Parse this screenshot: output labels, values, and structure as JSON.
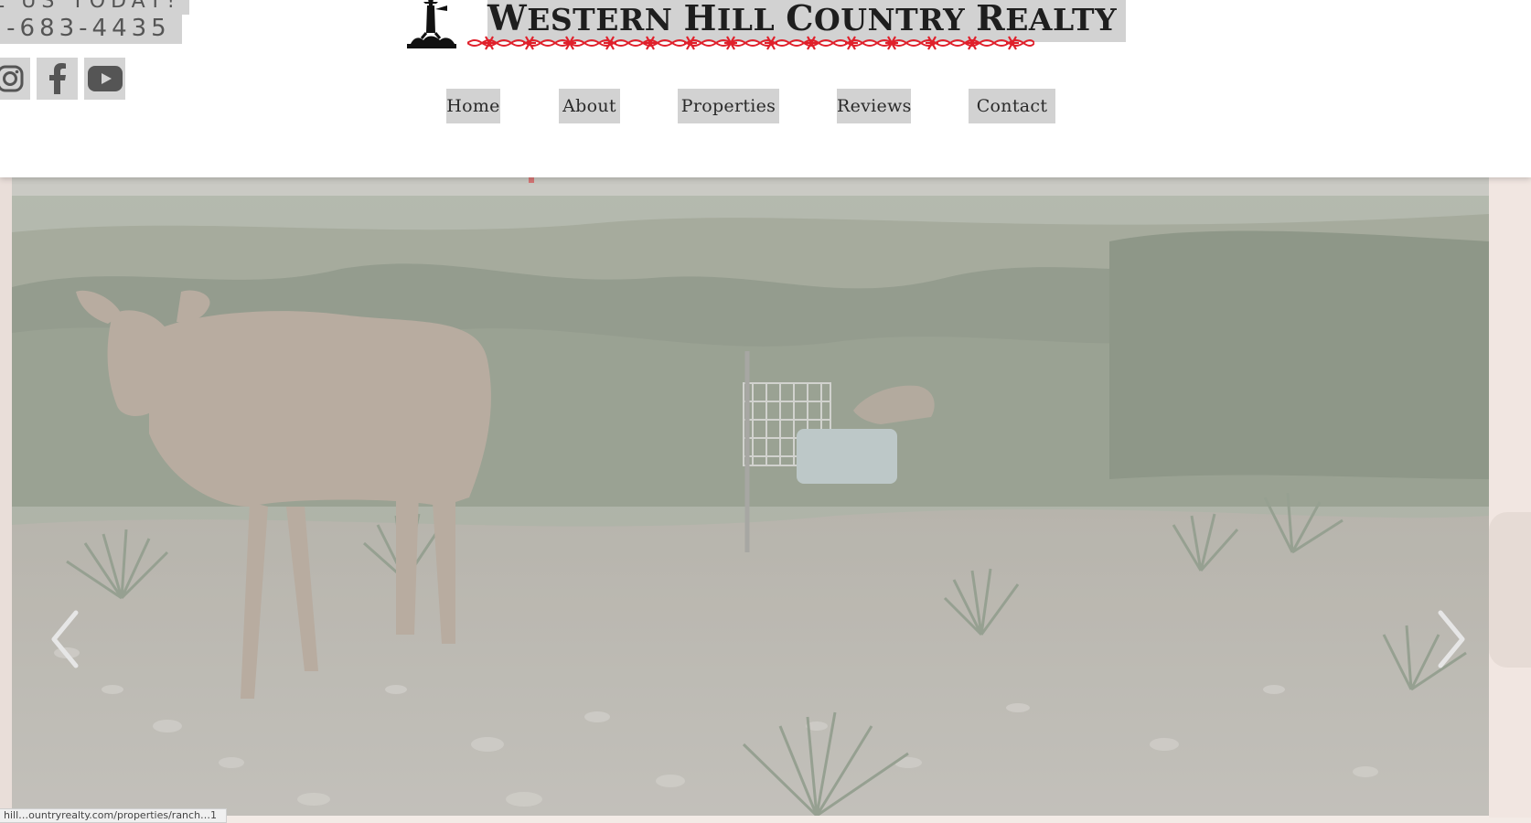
{
  "header": {
    "call_text": "L US TODAY!",
    "phone": ")-683-4435",
    "brand": {
      "first": "W",
      "rest1": "ESTERN ",
      "h": "H",
      "rest2": "ILL ",
      "c": "C",
      "rest3": "OUNTRY ",
      "r": "R",
      "rest4": "EALTY"
    },
    "social": [
      "instagram-icon",
      "facebook-icon",
      "youtube-icon"
    ],
    "colors": {
      "barbwire": "#e0202b",
      "highlight": "#d2d2d2"
    }
  },
  "nav": {
    "items": [
      {
        "label": "Home"
      },
      {
        "label": "About"
      },
      {
        "label": "Properties"
      },
      {
        "label": "Reviews"
      },
      {
        "label": "Contact"
      }
    ]
  },
  "hero": {
    "prev_icon": "chevron-left-icon",
    "next_icon": "chevron-right-icon"
  },
  "status_bar": {
    "url": "hill…ountryrealty.com/properties/ranch…1"
  }
}
